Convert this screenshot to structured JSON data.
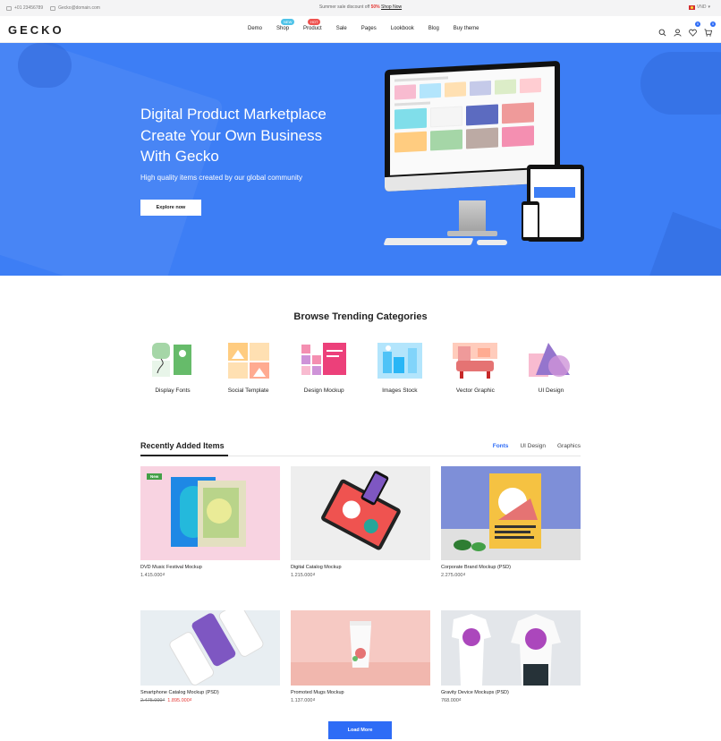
{
  "topbar": {
    "phone": "+01 23456789",
    "email": "Gecko@domain.com",
    "promo_text": "Summer sale discount off",
    "promo_percent": "50%",
    "promo_link": "Shop Now",
    "currency": "VND"
  },
  "header": {
    "logo": "GECKO",
    "nav": [
      {
        "label": "Demo"
      },
      {
        "label": "Shop",
        "badge": "NEW"
      },
      {
        "label": "Product",
        "badge": "HOT"
      },
      {
        "label": "Sale"
      },
      {
        "label": "Pages"
      },
      {
        "label": "Lookbook"
      },
      {
        "label": "Blog"
      },
      {
        "label": "Buy theme"
      }
    ],
    "wishlist_count": "0",
    "cart_count": "0"
  },
  "hero": {
    "title_lines": [
      "Digital Product Marketplace",
      "Create Your Own Business",
      "With Gecko"
    ],
    "subtitle": "High quality items created by our global community",
    "cta": "Explore now"
  },
  "categories": {
    "title": "Browse Trending Categories",
    "items": [
      {
        "label": "Display Fonts"
      },
      {
        "label": "Social Template"
      },
      {
        "label": "Design Mockup"
      },
      {
        "label": "Images Stock"
      },
      {
        "label": "Vector Graphic"
      },
      {
        "label": "UI Design"
      }
    ]
  },
  "recent": {
    "title": "Recently Added Items",
    "tabs": [
      "Fonts",
      "UI Design",
      "Graphics"
    ],
    "active_tab": "Fonts",
    "products": [
      {
        "name": "DVD Music Festival Mockup",
        "price": "1.415.000₫",
        "tag": "New"
      },
      {
        "name": "Digital Catalog Mockup",
        "price": "1.215.000₫"
      },
      {
        "name": "Corporate Brand Mockup (PSD)",
        "price": "2.275.000₫"
      },
      {
        "name": "Smartphone Catalog Mockup (PSD)",
        "old_price": "2.475.000₫",
        "sale_price": "1.895.000₫"
      },
      {
        "name": "Promoted Mugs Mockup",
        "price": "1.137.000₫"
      },
      {
        "name": "Gravity Device Mockups (PSD)",
        "price": "768.000₫"
      }
    ],
    "load_more": "Load More"
  },
  "colors": {
    "accent": "#2e6cf6",
    "hero_bg": "#3d7ef5",
    "sale": "#e53935",
    "new_tag": "#43a047"
  },
  "icons": [
    "phone-icon",
    "mail-icon",
    "flag-icon",
    "search-icon",
    "user-icon",
    "heart-icon",
    "cart-icon"
  ]
}
